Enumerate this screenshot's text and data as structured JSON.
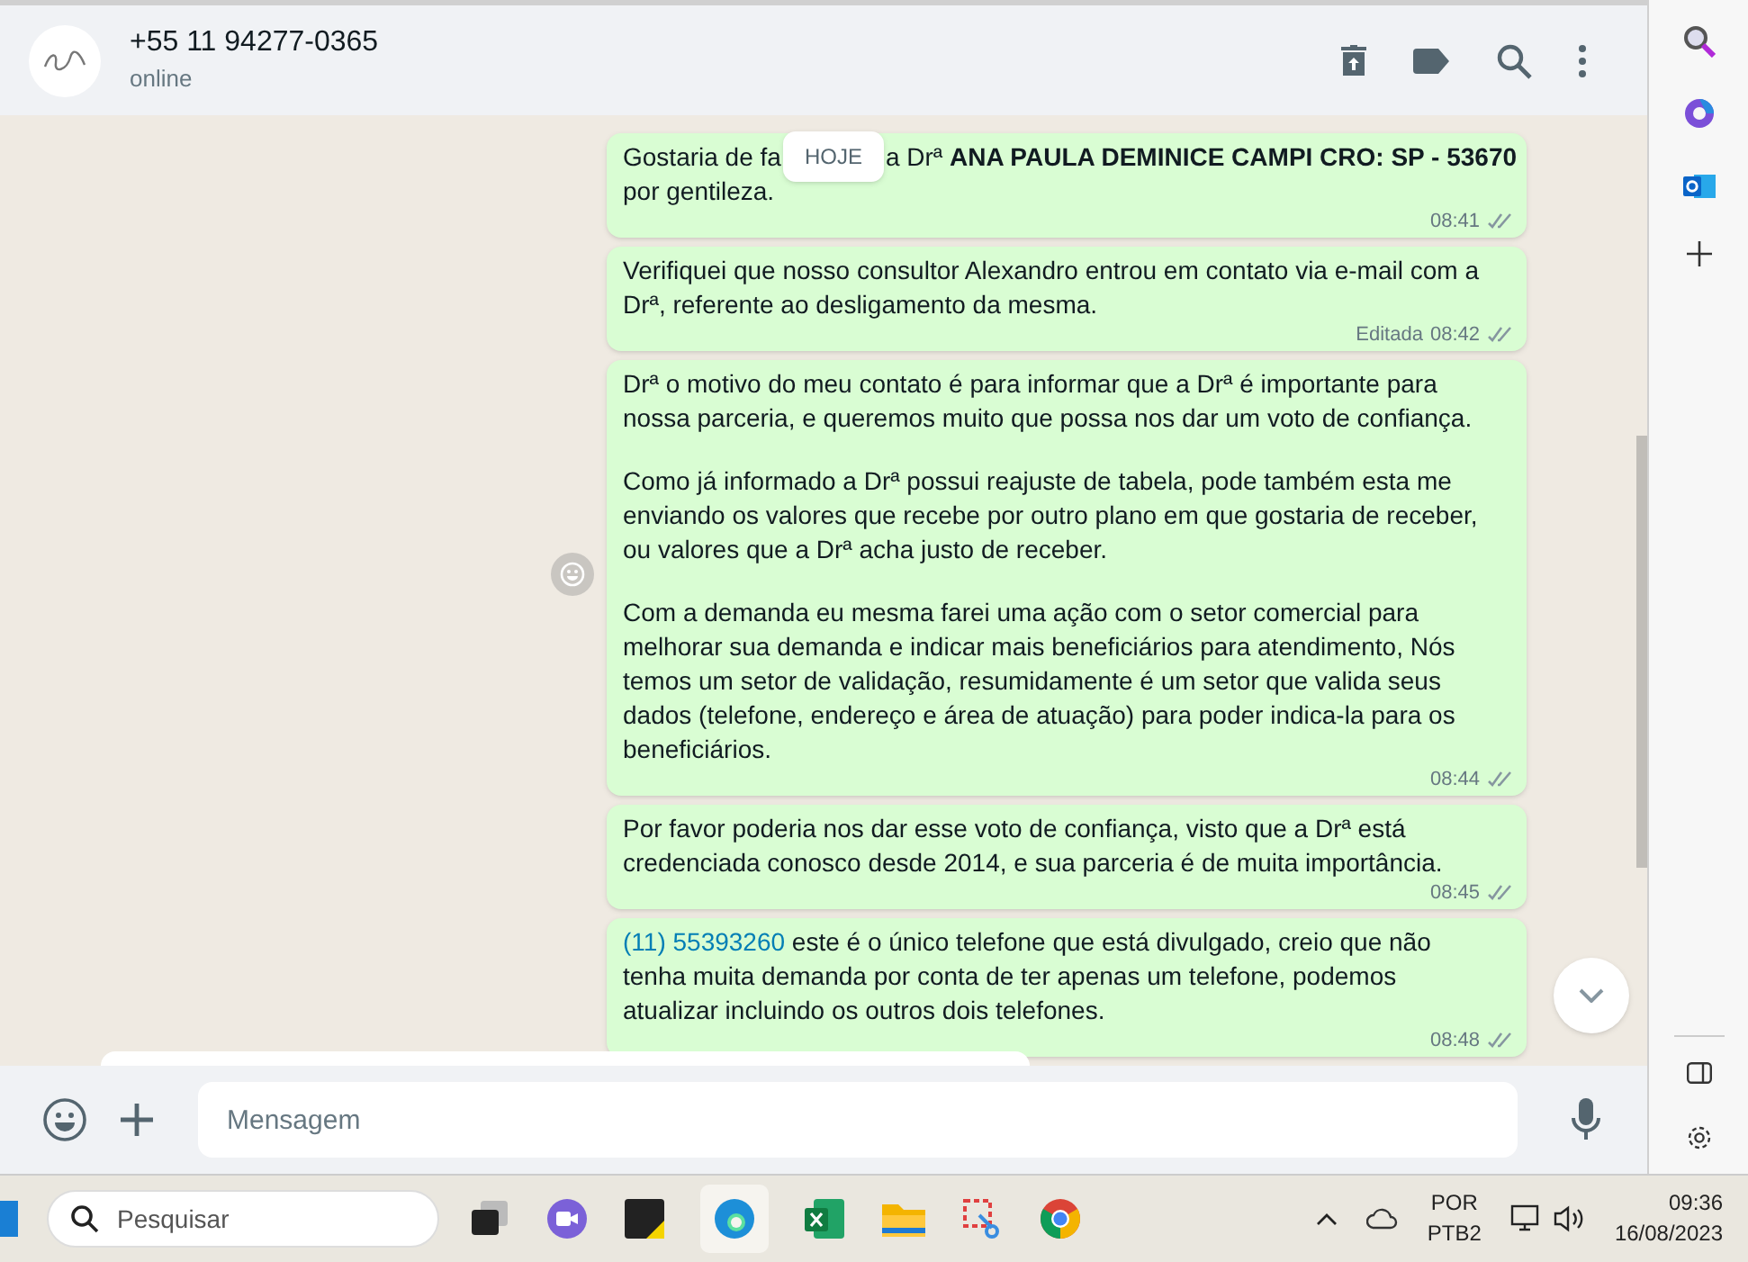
{
  "header": {
    "contact": "+55 11 94277-0365",
    "status": "online"
  },
  "date_badge": "HOJE",
  "messages": [
    {
      "kind": "split",
      "before": "Gostaria de fa",
      "after": "a Drª **ANA PAULA DEMINICE CAMPI CRO: SP - 53670**",
      "after_line2": "por gentileza.",
      "time": "08:41",
      "read": false
    },
    {
      "kind": "plain",
      "paragraphs": [
        "Verifiquei que nosso consultor Alexandro entrou em contato via e-mail com a Drª, referente ao desligamento da mesma."
      ],
      "edited": "Editada",
      "time": "08:42",
      "read": false
    },
    {
      "kind": "plain",
      "paragraphs": [
        "Drª o motivo do meu contato é para informar que a Drª é importante para nossa parceria, e queremos muito que possa nos dar um voto de confiança.",
        "Como já informado a Drª possui reajuste de tabela, pode também esta me enviando os valores que recebe por outro plano em que gostaria de receber, ou valores que a Drª acha justo de receber.",
        "Com a demanda eu mesma farei uma ação com o setor comercial para melhorar sua demanda e indicar mais beneficiários para atendimento, Nós temos um setor de validação, resumidamente é um setor que valida seus dados (telefone, endereço e área de atuação) para poder indica-la para os beneficiários."
      ],
      "time": "08:44",
      "read": false,
      "hovered": true
    },
    {
      "kind": "plain",
      "paragraphs": [
        "Por favor poderia nos dar esse voto de confiança, visto que a Drª está credenciada conosco desde 2014, e sua parceria é de muita importância."
      ],
      "time": "08:45",
      "read": false
    },
    {
      "kind": "link",
      "link": "(11) 55393260",
      "paragraphs": [
        "este é o único telefone que está divulgado, creio que não tenha muita demanda por conta de ter apenas um telefone, podemos atualizar incluindo os outros dois telefones."
      ],
      "time": "08:48",
      "read": false
    }
  ],
  "composer": {
    "placeholder": "Mensagem"
  },
  "taskbar": {
    "search_placeholder": "Pesquisar",
    "language": "POR",
    "layout": "PTB2",
    "time": "09:36",
    "date": "16/08/2023"
  }
}
